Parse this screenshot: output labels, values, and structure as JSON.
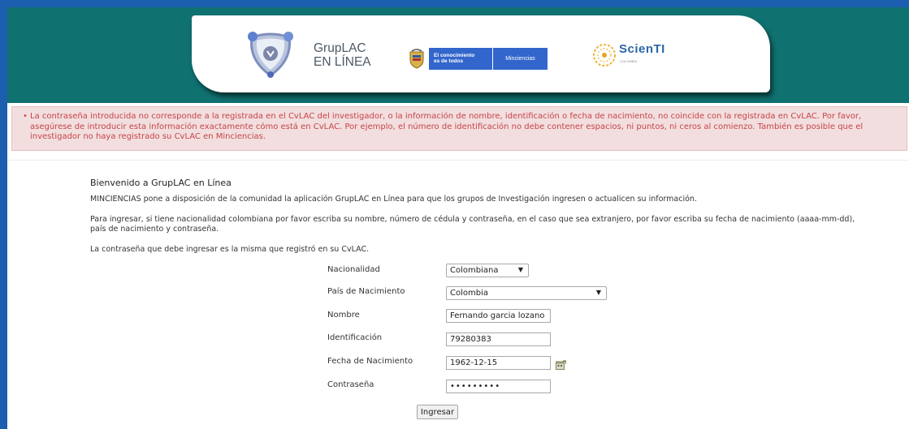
{
  "header": {
    "grup_title_line1": "GrupLAC",
    "grup_title_line2": "EN LÍNEA",
    "gov_text_line1": "El conocimiento",
    "gov_text_line2": "es de todos",
    "gov_ministry": "Minciencias",
    "scienti_name": "ScienTI",
    "scienti_sub": "COLOMBIA",
    "brand_teal": "#0f7170",
    "frame_blue": "#1c5fb0"
  },
  "error": {
    "bullet": "•",
    "message": "La contraseña introducida no corresponde a la registrada en el CvLAC del investigador, o la información de nombre, identificación o fecha de nacimiento, no coincide con la registrada en CvLAC. Por favor, asegúrese de introducir esta información exactamente cómo está en CvLAC. Por ejemplo, el número de identificación no debe contener espacios, ni puntos, ni ceros al comienzo. También es posible que el investigador no haya registrado su CvLAC en Minciencias.",
    "color": "#c74449",
    "background": "#f2dede"
  },
  "content": {
    "title": "Bienvenido a GrupLAC en Línea",
    "para1": "MINCIENCIAS pone a disposición de la comunidad la aplicación GrupLAC en Línea para que los grupos de Investigación ingresen o actualicen su información.",
    "para2": "Para ingresar, si tiene nacionalidad colombiana por favor escriba su nombre, número de cédula y contraseña, en el caso que sea extranjero, por favor escriba su fecha de nacimiento (aaaa-mm-dd), país de nacimiento y contraseña.",
    "para3": "La contraseña que debe ingresar es la misma que registró en su CvLAC."
  },
  "form": {
    "nacionalidad_label": "Nacionalidad",
    "nacionalidad_value": "Colombiana",
    "pais_label": "País de Nacimiento",
    "pais_value": "Colombia",
    "nombre_label": "Nombre",
    "nombre_value": "Fernando garcia lozano",
    "identificacion_label": "Identificación",
    "identificacion_value": "79280383",
    "fecha_label": "Fecha de Nacimiento",
    "fecha_value": "1962-12-15",
    "contrasena_label": "Contraseña",
    "contrasena_value": "•••••••••",
    "submit_label": "Ingresar",
    "calendar_icon": "calendar-icon"
  }
}
